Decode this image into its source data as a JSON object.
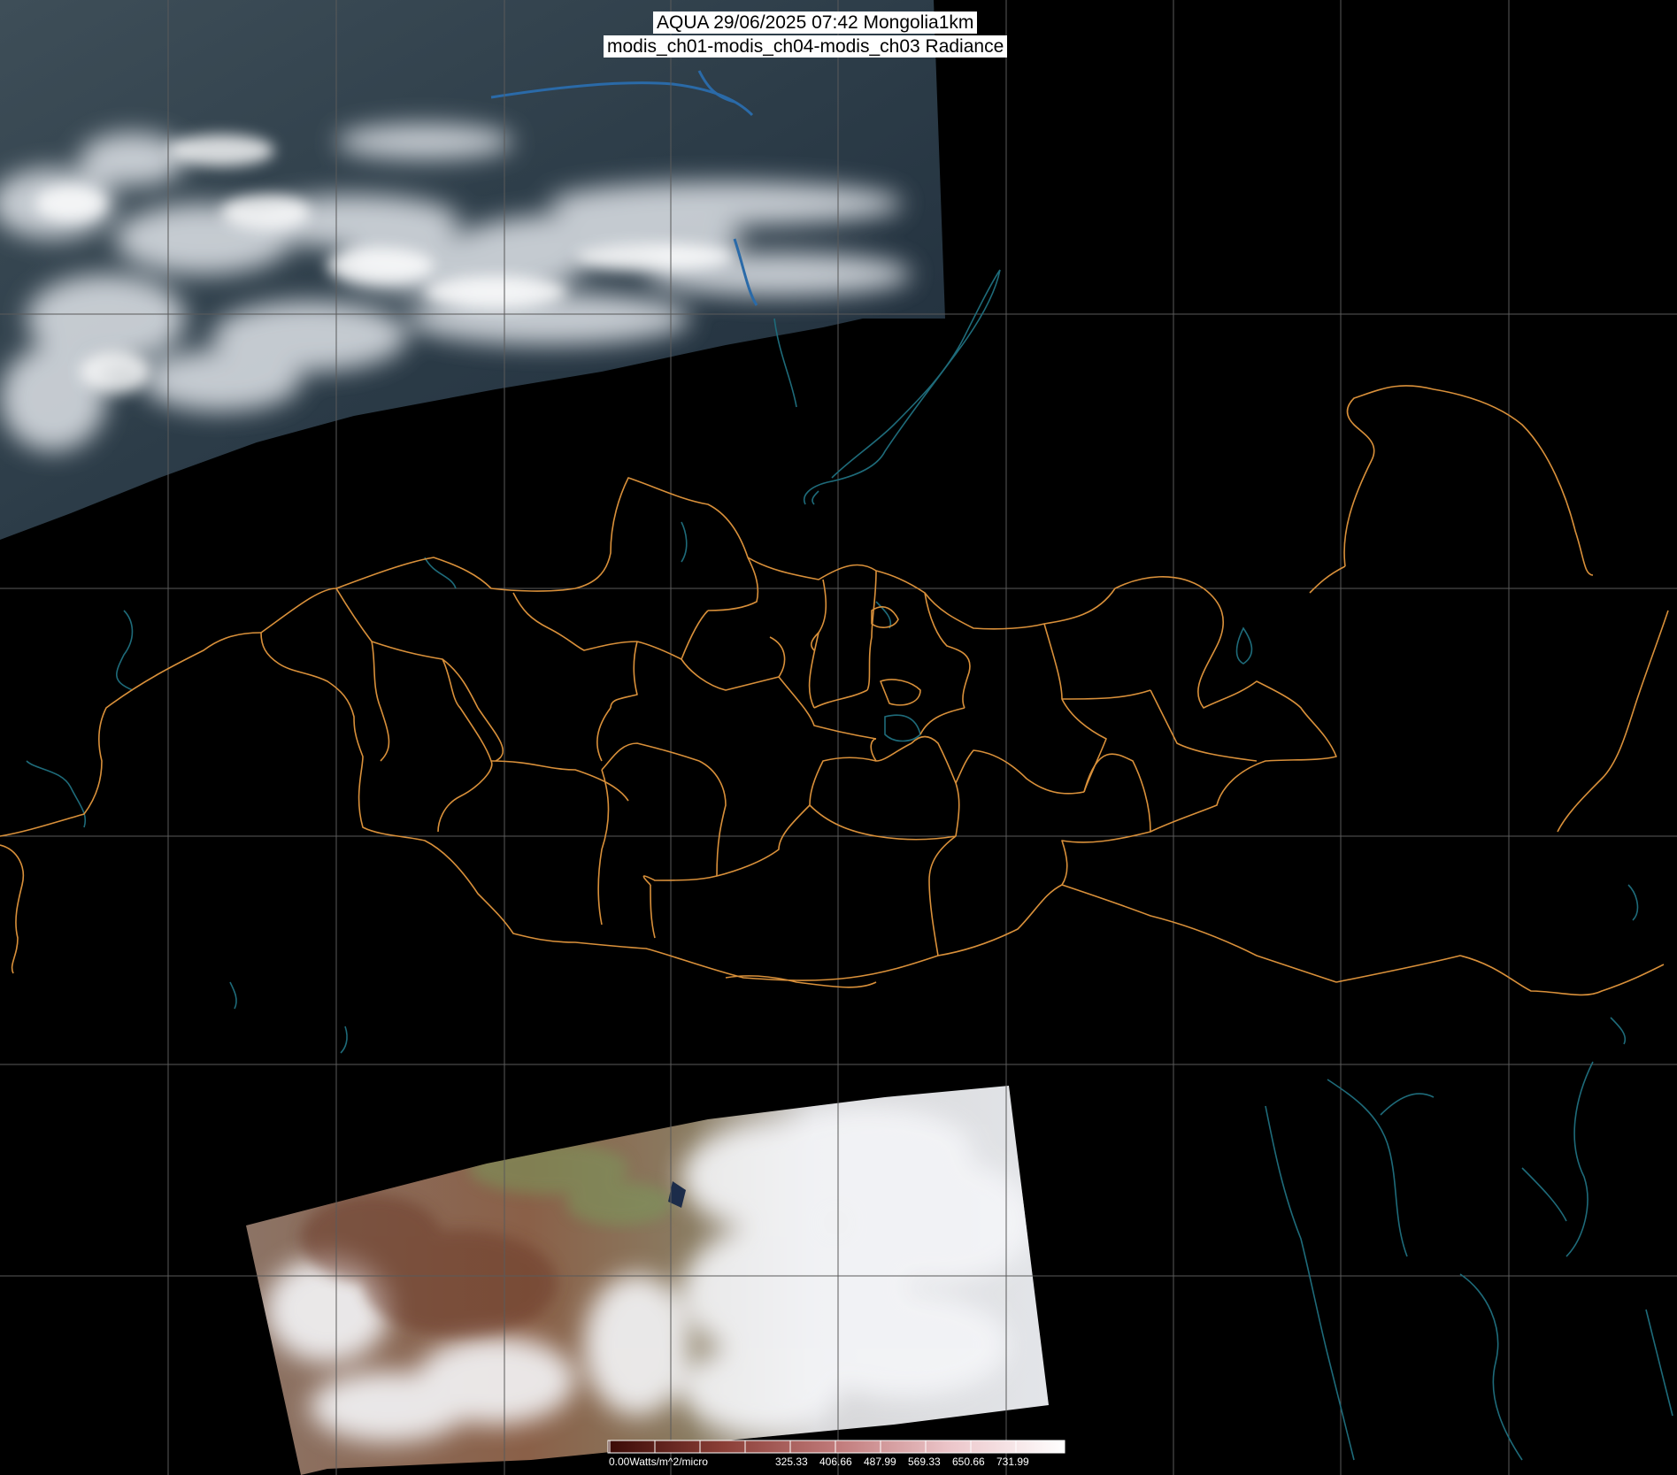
{
  "title": {
    "line1": "AQUA 29/06/2025 07:42 Mongolia1km",
    "line2": "modis_ch01-modis_ch04-modis_ch03 Radiance"
  },
  "colorbar": {
    "unit_label": "0.00Watts/m^2/micro",
    "ticks": [
      "325.33",
      "406.66",
      "487.99",
      "569.33",
      "650.66",
      "731.99"
    ],
    "colors": [
      "#3a0a06",
      "#5a1810",
      "#7a3028",
      "#9a4a44",
      "#b86a68",
      "#d08c8e",
      "#e2aeb0",
      "#efcdd0",
      "#f8e6ea",
      "#ffffff"
    ]
  },
  "colors": {
    "border": "#d9903a",
    "coastline": "#1e6b7a",
    "grid": "#5a5a5a",
    "background": "#000000"
  }
}
